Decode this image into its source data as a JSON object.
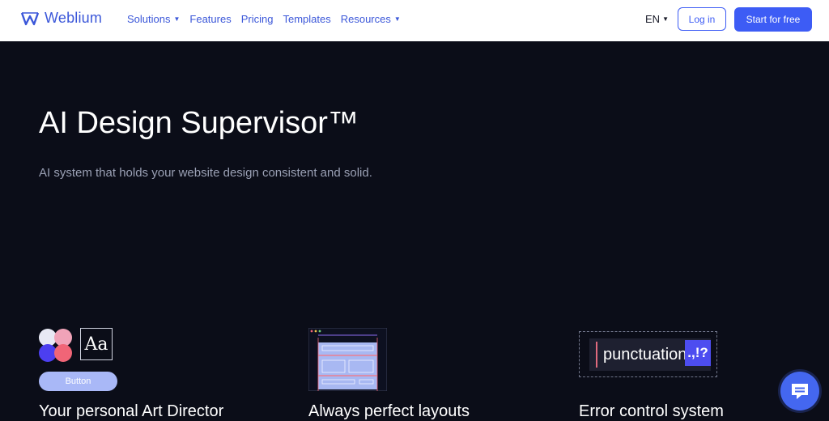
{
  "brand": {
    "name": "Weblium",
    "color": "#3b57d9"
  },
  "nav": {
    "items": [
      {
        "label": "Solutions",
        "has_caret": true
      },
      {
        "label": "Features",
        "has_caret": false
      },
      {
        "label": "Pricing",
        "has_caret": false
      },
      {
        "label": "Templates",
        "has_caret": false
      },
      {
        "label": "Resources",
        "has_caret": true
      }
    ],
    "language": "EN",
    "login_label": "Log in",
    "start_label": "Start for free"
  },
  "hero": {
    "title": "AI Design Supervisor™",
    "subtitle": "AI system that holds your website design consistent and solid."
  },
  "features": [
    {
      "title": "Your personal Art Director",
      "illustration": {
        "button_label": "Button",
        "type_sample": "Aa"
      }
    },
    {
      "title": "Always perfect layouts",
      "illustration": {
        "kind": "layout-grid"
      }
    },
    {
      "title": "Error control system",
      "illustration": {
        "word": "punctuation",
        "marks": ".,!?"
      }
    }
  ],
  "colors": {
    "background": "#0b0d18",
    "accent": "#3d5cf5",
    "dot_colors": [
      "#e8e9f5",
      "#f0a3b8",
      "#4c3ff0",
      "#f06577"
    ]
  },
  "icons": {
    "logo": "weblium-w-icon",
    "chat": "chat-bubble-icon",
    "caret": "caret-down-icon",
    "cursor": "text-cursor-icon"
  }
}
